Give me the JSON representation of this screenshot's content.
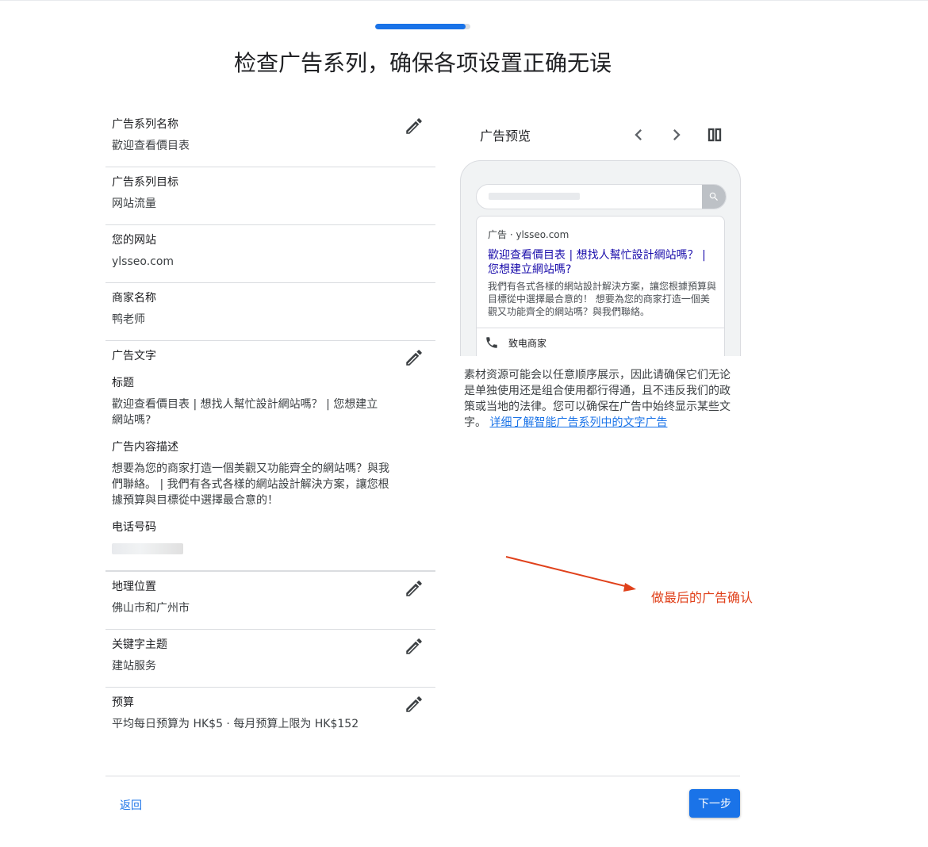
{
  "progress": {
    "fraction": 0.95
  },
  "page_title": "检查广告系列，确保各项设置正确无误",
  "summary": {
    "campaign_name": {
      "label": "广告系列名称",
      "value": "歡迎查看價目表"
    },
    "campaign_goal": {
      "label": "广告系列目标",
      "value": "网站流量"
    },
    "website": {
      "label": "您的网站",
      "value": "ylsseo.com"
    },
    "business_name": {
      "label": "商家名称",
      "value": "鸭老师"
    },
    "ad_text": {
      "label": "广告文字",
      "headline_label": "标题",
      "headline_value": "歡迎查看價目表 | 想找人幫忙設計網站嗎？ | 您想建立網站嗎?",
      "description_label": "广告内容描述",
      "description_value": "想要為您的商家打造一個美觀又功能齊全的網站嗎？與我們聯絡。 | 我們有各式各樣的網站設計解決方案，讓您根據預算與目標從中選擇最合意的！",
      "phone_label": "电话号码"
    },
    "location": {
      "label": "地理位置",
      "value": "佛山市和广州市"
    },
    "keywords": {
      "label": "关键字主题",
      "value": "建站服务"
    },
    "budget": {
      "label": "预算",
      "value": "平均每日预算为 HK$5 · 每月预算上限为 HK$152"
    }
  },
  "preview": {
    "title": "广告预览",
    "ad_meta": "广告 · ylsseo.com",
    "ad_headline": "歡迎查看價目表 | 想找人幫忙設計網站嗎？ | 您想建立網站嗎?",
    "ad_description": "我們有各式各樣的網站設計解決方案，讓您根據預算與目標從中選擇最合意的！ 想要為您的商家打造一個美觀又功能齊全的網站嗎？與我們聯絡。",
    "call_label": "致电商家"
  },
  "note": {
    "text": "素材资源可能会以任意顺序展示，因此请确保它们无论是单独使用还是组合使用都行得通，且不违反我们的政策或当地的法律。您可以确保在广告中始终显示某些文字。",
    "link": "详细了解智能广告系列中的文字广告"
  },
  "annotation": {
    "text": "做最后的广告确认",
    "color": "#e0411b"
  },
  "footer": {
    "back": "返回",
    "next": "下一步"
  },
  "colors": {
    "primary": "#1a73e8",
    "ad_link": "#1a0dab"
  },
  "icons": [
    "edit-pencil-icon",
    "chevron-left-icon",
    "chevron-right-icon",
    "split-view-icon",
    "search-icon",
    "phone-icon"
  ]
}
